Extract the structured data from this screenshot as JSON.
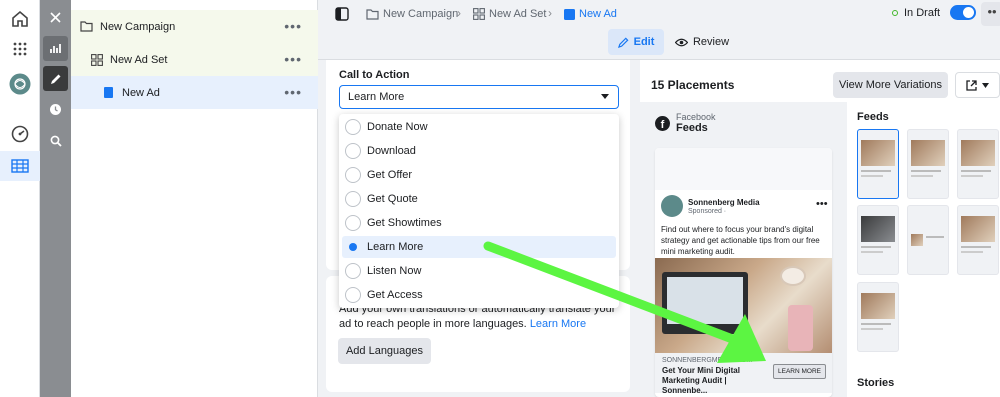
{
  "tree": {
    "campaign": "New Campaign",
    "adset": "New Ad Set",
    "ad": "New Ad",
    "more": "•••"
  },
  "breadcrumb": {
    "campaign": "New Campaign",
    "adset": "New Ad Set",
    "ad": "New Ad",
    "separator": "›"
  },
  "tabs": {
    "edit": "Edit",
    "review": "Review"
  },
  "status": {
    "label": "In Draft",
    "more": "••"
  },
  "cta": {
    "label": "Call to Action",
    "selected": "Learn More",
    "options": [
      "Donate Now",
      "Download",
      "Get Offer",
      "Get Quote",
      "Get Showtimes",
      "Learn More",
      "Listen Now",
      "Get Access"
    ]
  },
  "translate": {
    "text": "Add your own translations or automatically translate your ad to reach people in more languages.",
    "link": "Learn More",
    "button": "Add Languages"
  },
  "preview": {
    "title": "15 Placements",
    "view_more": "View More Variations",
    "platform": "Facebook",
    "placement": "Feeds",
    "post": {
      "page_name": "Sonnenberg Media",
      "sponsored": "Sponsored ·",
      "more": "•••",
      "body": "Find out where to focus your brand's digital strategy and get actionable tips from our free mini marketing audit.",
      "url": "SONNENBERGMEDIA.COM",
      "headline": "Get Your Mini Digital Marketing Audit | Sonnenbe...",
      "cta_button": "LEARN MORE"
    },
    "sections": {
      "feeds": "Feeds",
      "stories": "Stories"
    }
  },
  "colors": {
    "accent": "#1877f2",
    "arrow": "#5cf542",
    "draft_dot": "#42b72a"
  }
}
